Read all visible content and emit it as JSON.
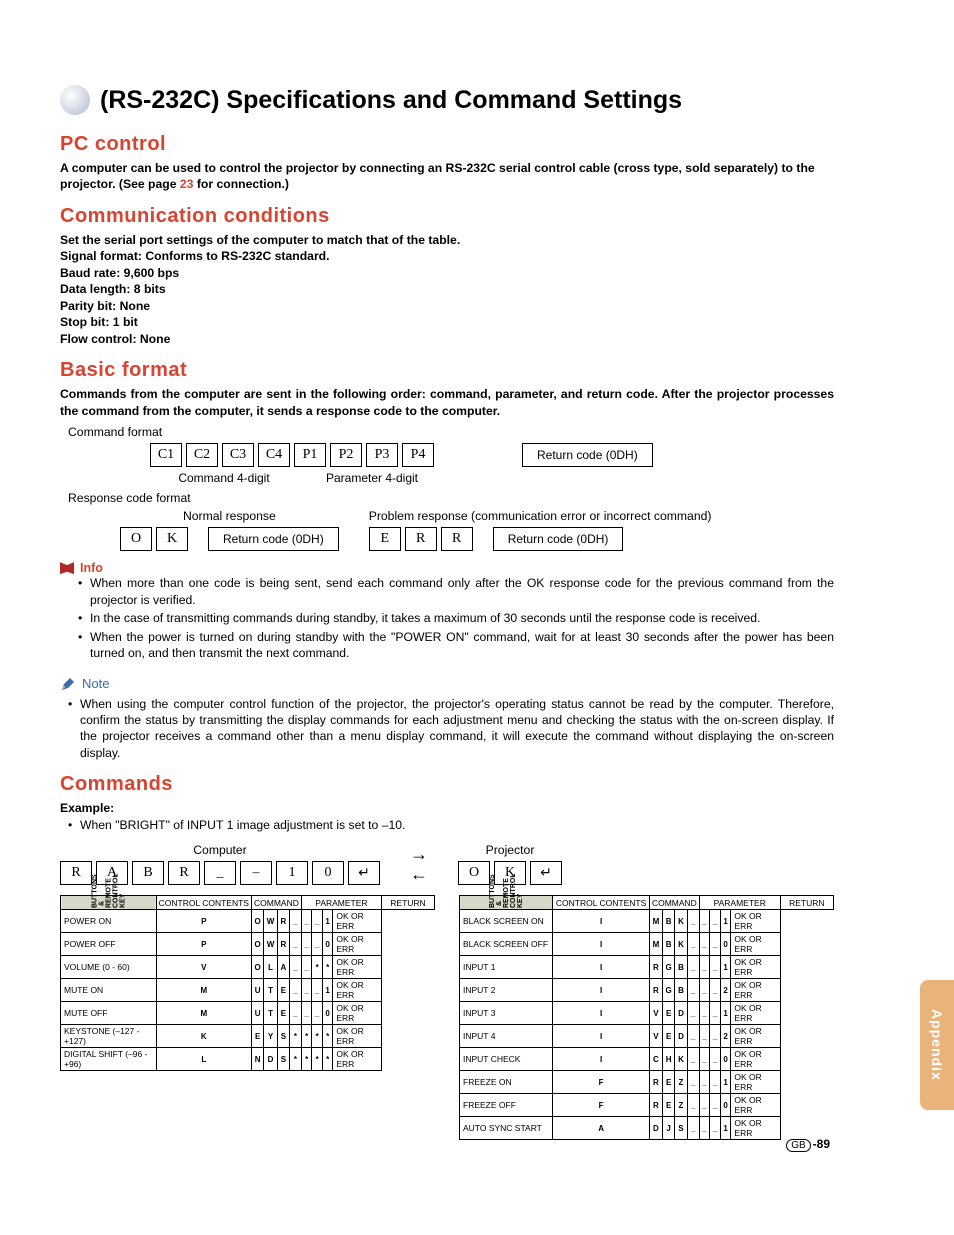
{
  "sideTab": "Appendix",
  "pageNumber": "-89",
  "gbLabel": "GB",
  "title": "(RS-232C) Specifications and Command Settings",
  "pcControl": {
    "heading": "PC control",
    "text": "A computer can be used to control the projector by connecting an RS-232C serial control cable (cross type, sold separately) to the projector. (See page ",
    "pageRef": "23",
    "textEnd": " for connection.)"
  },
  "comm": {
    "heading": "Communication conditions",
    "line1": "Set the serial port settings of the computer to match that of the table.",
    "line2": "Signal format: Conforms to RS-232C standard.",
    "line3": "Baud rate: 9,600 bps",
    "line4": "Data length: 8 bits",
    "line5": "Parity bit: None",
    "line6": "Stop bit: 1 bit",
    "line7": "Flow control: None"
  },
  "basic": {
    "heading": "Basic format",
    "intro": "Commands from the computer are sent in the following order: command, parameter, and return code. After the projector processes the command from the computer, it sends a response code to the computer.",
    "cmdFormatLabel": "Command format",
    "cells": {
      "c1": "C1",
      "c2": "C2",
      "c3": "C3",
      "c4": "C4",
      "p1": "P1",
      "p2": "P2",
      "p3": "P3",
      "p4": "P4"
    },
    "returnCode": "Return code (0DH)",
    "cmd4": "Command 4-digit",
    "param4": "Parameter 4-digit",
    "respFormatLabel": "Response code format",
    "normalResp": "Normal response",
    "problemResp": "Problem response (communication error or incorrect command)",
    "ok": {
      "o": "O",
      "k": "K"
    },
    "err": {
      "e": "E",
      "r1": "R",
      "r2": "R"
    }
  },
  "info": {
    "label": "Info",
    "b1": "When more than one code is being sent, send each command only after the OK response code for the previous command from the projector is verified.",
    "b2": "In the case of transmitting commands during standby, it takes a maximum of 30 seconds until the response code is received.",
    "b3": "When the power is turned on during standby with the \"POWER ON\" command, wait for at least 30 seconds after the power has been turned on, and then transmit the next command."
  },
  "note": {
    "label": "Note",
    "b1": "When using the computer control function of the projector, the projector's operating status cannot be read by the computer. Therefore, confirm the status by transmitting the display commands for each adjustment menu and checking the status with the on-screen display. If the projector receives a command other than a menu display command, it will execute the command without displaying the on-screen display."
  },
  "commands": {
    "heading": "Commands",
    "exampleLabel": "Example:",
    "exampleText": "When \"BRIGHT\" of INPUT 1 image adjustment is set to –10.",
    "computerLabel": "Computer",
    "projectorLabel": "Projector",
    "exCells": [
      "R",
      "A",
      "B",
      "R",
      "_",
      "–",
      "1",
      "0"
    ],
    "retGlyph": "↵",
    "okCells": [
      "O",
      "K"
    ]
  },
  "tableHeaders": {
    "control": "CONTROL CONTENTS",
    "command": "COMMAND",
    "parameter": "PARAMETER",
    "return": "RETURN",
    "side": "BUTTONS & REMOTE CONTROL KEY"
  },
  "leftTable": [
    {
      "name": "POWER ON",
      "cmd": [
        "P",
        "O",
        "W",
        "R"
      ],
      "param": [
        "_",
        "_",
        "_",
        "1"
      ],
      "ret": "OK OR ERR"
    },
    {
      "name": "POWER OFF",
      "cmd": [
        "P",
        "O",
        "W",
        "R"
      ],
      "param": [
        "_",
        "_",
        "_",
        "0"
      ],
      "ret": "OK OR ERR"
    },
    {
      "name": "VOLUME (0 - 60)",
      "cmd": [
        "V",
        "O",
        "L",
        "A"
      ],
      "param": [
        "_",
        "_",
        "*",
        "*"
      ],
      "ret": "OK OR ERR"
    },
    {
      "name": "MUTE ON",
      "cmd": [
        "M",
        "U",
        "T",
        "E"
      ],
      "param": [
        "_",
        "_",
        "_",
        "1"
      ],
      "ret": "OK OR ERR"
    },
    {
      "name": "MUTE OFF",
      "cmd": [
        "M",
        "U",
        "T",
        "E"
      ],
      "param": [
        "_",
        "_",
        "_",
        "0"
      ],
      "ret": "OK OR ERR"
    },
    {
      "name": "KEYSTONE (–127 - +127)",
      "cmd": [
        "K",
        "E",
        "Y",
        "S"
      ],
      "param": [
        "*",
        "*",
        "*",
        "*"
      ],
      "ret": "OK OR ERR"
    },
    {
      "name": "DIGITAL SHIFT (–96 - +96)",
      "cmd": [
        "L",
        "N",
        "D",
        "S"
      ],
      "param": [
        "*",
        "*",
        "*",
        "*"
      ],
      "ret": "OK OR ERR"
    }
  ],
  "rightTable": [
    {
      "name": "BLACK SCREEN ON",
      "cmd": [
        "I",
        "M",
        "B",
        "K"
      ],
      "param": [
        "_",
        "_",
        "_",
        "1"
      ],
      "ret": "OK OR ERR"
    },
    {
      "name": "BLACK SCREEN OFF",
      "cmd": [
        "I",
        "M",
        "B",
        "K"
      ],
      "param": [
        "_",
        "_",
        "_",
        "0"
      ],
      "ret": "OK OR ERR"
    },
    {
      "name": "INPUT 1",
      "cmd": [
        "I",
        "R",
        "G",
        "B"
      ],
      "param": [
        "_",
        "_",
        "_",
        "1"
      ],
      "ret": "OK OR ERR"
    },
    {
      "name": "INPUT 2",
      "cmd": [
        "I",
        "R",
        "G",
        "B"
      ],
      "param": [
        "_",
        "_",
        "_",
        "2"
      ],
      "ret": "OK OR ERR"
    },
    {
      "name": "INPUT 3",
      "cmd": [
        "I",
        "V",
        "E",
        "D"
      ],
      "param": [
        "_",
        "_",
        "_",
        "1"
      ],
      "ret": "OK OR ERR"
    },
    {
      "name": "INPUT 4",
      "cmd": [
        "I",
        "V",
        "E",
        "D"
      ],
      "param": [
        "_",
        "_",
        "_",
        "2"
      ],
      "ret": "OK OR ERR"
    },
    {
      "name": "INPUT CHECK",
      "cmd": [
        "I",
        "C",
        "H",
        "K"
      ],
      "param": [
        "_",
        "_",
        "_",
        "0"
      ],
      "ret": "OK OR ERR"
    },
    {
      "name": "FREEZE ON",
      "cmd": [
        "F",
        "R",
        "E",
        "Z"
      ],
      "param": [
        "_",
        "_",
        "_",
        "1"
      ],
      "ret": "OK OR ERR"
    },
    {
      "name": "FREEZE OFF",
      "cmd": [
        "F",
        "R",
        "E",
        "Z"
      ],
      "param": [
        "_",
        "_",
        "_",
        "0"
      ],
      "ret": "OK OR ERR"
    },
    {
      "name": "AUTO SYNC START",
      "cmd": [
        "A",
        "D",
        "J",
        "S"
      ],
      "param": [
        "_",
        "_",
        "_",
        "1"
      ],
      "ret": "OK OR ERR"
    }
  ]
}
